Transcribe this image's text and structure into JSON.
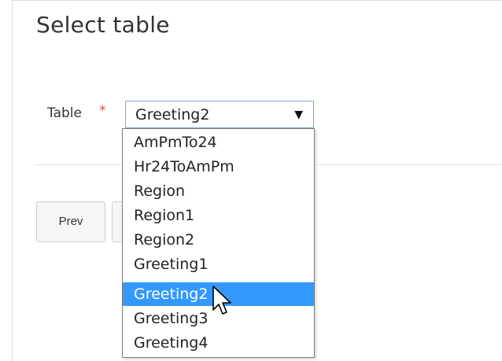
{
  "page": {
    "title": "Select table"
  },
  "form": {
    "table_label": "Table",
    "required_marker": "*",
    "selected_value": "Greeting2",
    "dropdown_arrow": "▼"
  },
  "dropdown": {
    "options": [
      "AmPmTo24",
      "Hr24ToAmPm",
      "Region",
      "Region1",
      "Region2",
      "Greeting1",
      "Greeting2",
      "Greeting3",
      "Greeting4"
    ],
    "highlighted_index": 6,
    "highlight_color": "#3399ff"
  },
  "buttons": {
    "prev_label": "Prev",
    "next_label": ""
  },
  "icons": {
    "cursor": "mouse-pointer-icon"
  }
}
